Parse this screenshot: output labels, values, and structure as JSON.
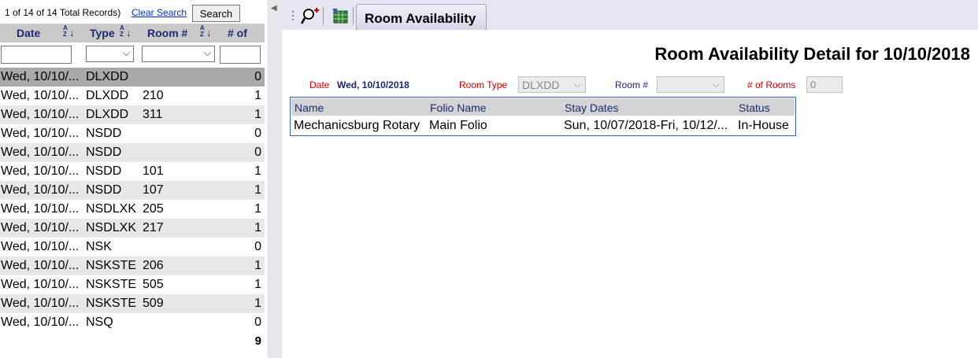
{
  "left": {
    "record_count": "1 of 14 of 14 Total Records)",
    "clear_search": "Clear Search",
    "search_button": "Search",
    "columns": [
      "Date",
      "Type",
      "Room #",
      "# of"
    ],
    "sort_icon_text": "AZ",
    "rows": [
      {
        "date": "Wed, 10/10/...",
        "type": "DLXDD",
        "room": "",
        "num": "0"
      },
      {
        "date": "Wed, 10/10/...",
        "type": "DLXDD",
        "room": "210",
        "num": "1"
      },
      {
        "date": "Wed, 10/10/...",
        "type": "DLXDD",
        "room": "311",
        "num": "1"
      },
      {
        "date": "Wed, 10/10/...",
        "type": "NSDD",
        "room": "",
        "num": "0"
      },
      {
        "date": "Wed, 10/10/...",
        "type": "NSDD",
        "room": "",
        "num": "0"
      },
      {
        "date": "Wed, 10/10/...",
        "type": "NSDD",
        "room": "101",
        "num": "1"
      },
      {
        "date": "Wed, 10/10/...",
        "type": "NSDD",
        "room": "107",
        "num": "1"
      },
      {
        "date": "Wed, 10/10/...",
        "type": "NSDLXK",
        "room": "205",
        "num": "1"
      },
      {
        "date": "Wed, 10/10/...",
        "type": "NSDLXK",
        "room": "217",
        "num": "1"
      },
      {
        "date": "Wed, 10/10/...",
        "type": "NSK",
        "room": "",
        "num": "0"
      },
      {
        "date": "Wed, 10/10/...",
        "type": "NSKSTE",
        "room": "206",
        "num": "1"
      },
      {
        "date": "Wed, 10/10/...",
        "type": "NSKSTE",
        "room": "505",
        "num": "1"
      },
      {
        "date": "Wed, 10/10/...",
        "type": "NSKSTE",
        "room": "509",
        "num": "1"
      },
      {
        "date": "Wed, 10/10/...",
        "type": "NSQ",
        "room": "",
        "num": "0"
      }
    ],
    "total": "9"
  },
  "toolbar": {
    "tab_label": "Room Availability"
  },
  "detail": {
    "title": "Room Availability Detail for 10/10/2018",
    "date_label": "Date",
    "date_value": "Wed, 10/10/2018",
    "room_type_label": "Room Type",
    "room_type_value": "DLXDD",
    "room_num_label": "Room #",
    "room_num_value": "",
    "num_rooms_label": "# of Rooms",
    "num_rooms_value": "0",
    "table": {
      "headers": [
        "Name",
        "Folio Name",
        "Stay Dates",
        "Status"
      ],
      "rows": [
        {
          "name": "Mechanicsburg Rotary",
          "folio": "Main Folio",
          "stay": "Sun, 10/07/2018-Fri, 10/12/...",
          "status": "In-House"
        }
      ]
    }
  },
  "colors": {
    "header_text": "#1a2a6e",
    "label_red": "#cc0000",
    "selected_row": "#a9a9a9",
    "alt_row": "#e8e8e8",
    "toolbar_bg": "#e6e6f2"
  }
}
